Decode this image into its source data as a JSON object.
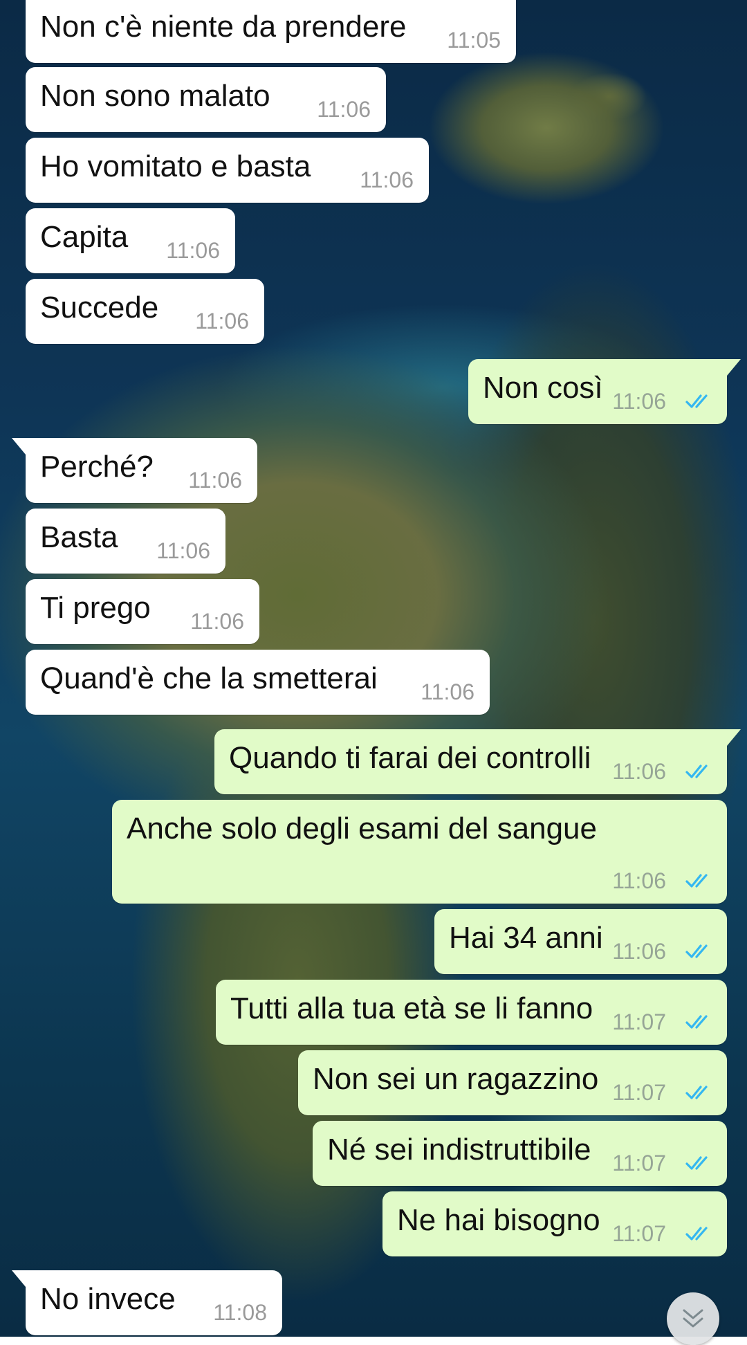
{
  "chat": {
    "messages": [
      {
        "direction": "in",
        "text": "Non c'è niente da prendere",
        "time": "11:05"
      },
      {
        "direction": "in",
        "text": "Non sono malato",
        "time": "11:06"
      },
      {
        "direction": "in",
        "text": "Ho vomitato e basta",
        "time": "11:06"
      },
      {
        "direction": "in",
        "text": "Capita",
        "time": "11:06"
      },
      {
        "direction": "in",
        "text": "Succede",
        "time": "11:06"
      },
      {
        "direction": "out",
        "text": "Non così",
        "time": "11:06",
        "status": "read"
      },
      {
        "direction": "in",
        "text": "Perché?",
        "time": "11:06"
      },
      {
        "direction": "in",
        "text": "Basta",
        "time": "11:06"
      },
      {
        "direction": "in",
        "text": "Ti prego",
        "time": "11:06"
      },
      {
        "direction": "in",
        "text": "Quand'è che la smetterai",
        "time": "11:06"
      },
      {
        "direction": "out",
        "text": "Quando ti farai dei controlli",
        "time": "11:06",
        "status": "read"
      },
      {
        "direction": "out",
        "text": "Anche solo degli esami del sangue",
        "time": "11:06",
        "status": "read"
      },
      {
        "direction": "out",
        "text": "Hai 34 anni",
        "time": "11:06",
        "status": "read"
      },
      {
        "direction": "out",
        "text": "Tutti alla tua età se li fanno",
        "time": "11:07",
        "status": "read"
      },
      {
        "direction": "out",
        "text": "Non sei un ragazzino",
        "time": "11:07",
        "status": "read"
      },
      {
        "direction": "out",
        "text": "Né sei indistruttibile",
        "time": "11:07",
        "status": "read"
      },
      {
        "direction": "out",
        "text": "Ne hai bisogno",
        "time": "11:07",
        "status": "read"
      },
      {
        "direction": "in",
        "text": "No invece",
        "time": "11:08"
      }
    ]
  },
  "icons": {
    "read_receipt": "double-check-icon",
    "scroll_down": "chevron-double-down-icon"
  },
  "colors": {
    "incoming_bubble": "#ffffff",
    "outgoing_bubble": "#e1fbc8",
    "read_tick": "#34b7f1",
    "timestamp": "#9a9a9a"
  }
}
